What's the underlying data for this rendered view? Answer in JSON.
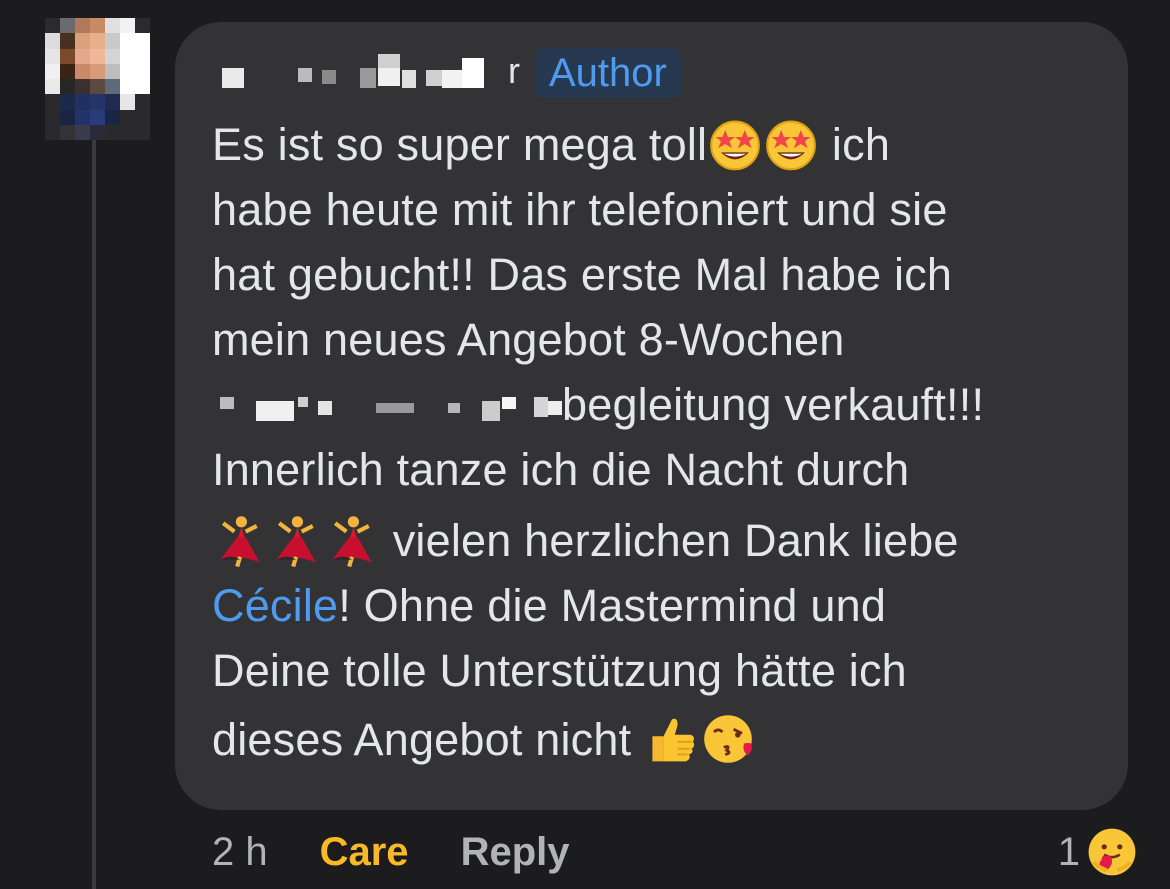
{
  "comment": {
    "author_tail": "r",
    "author_badge": "Author",
    "lines": {
      "l1": "Es ist so super mega toll",
      "l1_end": " ich",
      "l2": "habe heute mit ihr telefoniert und sie",
      "l3": "hat gebucht!! Das erste Mal habe ich",
      "l4": "mein neues Angebot 8-Wochen",
      "l5_end": "begleitung verkauft!!!",
      "l6": "Innerlich tanze ich die Nacht durch",
      "l7": " vielen herzlichen Dank liebe",
      "l8_mention": "Cécile",
      "l8_rest": "! Ohne die Mastermind und",
      "l9": "Deine tolle Unterstützung hätte ich",
      "l10": "dieses Angebot nicht"
    },
    "emojis": [
      "star-struck",
      "star-struck",
      "woman-dancing",
      "woman-dancing",
      "woman-dancing",
      "thumbs-up",
      "kissing-face-with-heart"
    ]
  },
  "footer": {
    "time": "2 h",
    "care_label": "Care",
    "reply_label": "Reply"
  },
  "reaction": {
    "count": "1",
    "type": "care"
  },
  "colors": {
    "background": "#1c1c1e",
    "bubble": "#333335",
    "text": "#e4e6eb",
    "mention": "#4e9bef",
    "care": "#f7b928",
    "muted": "#b0b3b8",
    "badge_bg": "#263951"
  }
}
